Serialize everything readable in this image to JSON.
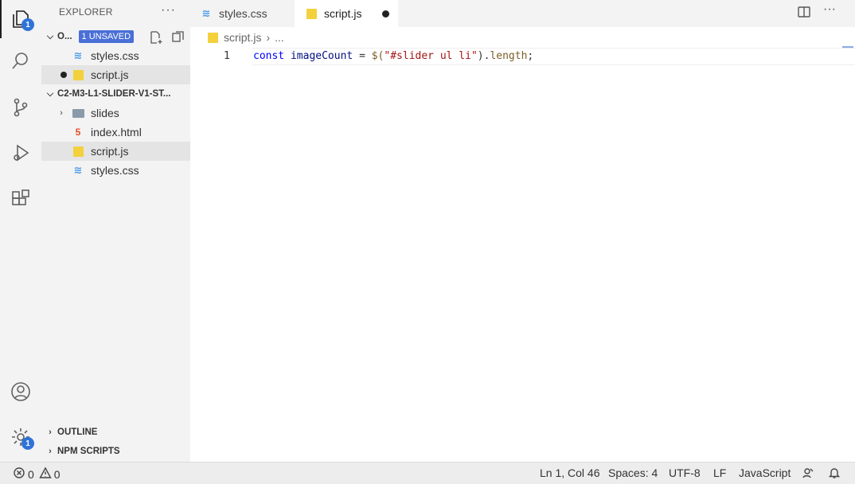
{
  "activity_bar": {
    "explorer_badge": "1",
    "settings_badge": "1"
  },
  "sidebar": {
    "title": "EXPLORER",
    "more": "···",
    "open_editors": {
      "label": "O...",
      "unsaved_badge": "1 UNSAVED",
      "files": [
        {
          "name": "styles.css",
          "type": "css"
        },
        {
          "name": "script.js",
          "type": "js"
        }
      ]
    },
    "folder": {
      "label": "C2-M3-L1-SLIDER-V1-ST...",
      "items": [
        {
          "name": "slides",
          "type": "folder"
        },
        {
          "name": "index.html",
          "type": "html"
        },
        {
          "name": "script.js",
          "type": "js"
        },
        {
          "name": "styles.css",
          "type": "css"
        }
      ]
    },
    "outline_label": "OUTLINE",
    "npm_label": "NPM SCRIPTS"
  },
  "tabs": [
    {
      "label": "styles.css",
      "type": "css",
      "active": false
    },
    {
      "label": "script.js",
      "type": "js",
      "active": true,
      "dirty": true
    }
  ],
  "breadcrumb": {
    "file": "script.js",
    "rest": "..."
  },
  "editor": {
    "lines": [
      {
        "number": "1",
        "tokens": {
          "kw": "const",
          "var": "imageCount",
          "eq": "=",
          "fn": "$(",
          "str": "\"#slider ul li\"",
          "close": ").",
          "prop": "length",
          "semi": ";"
        }
      }
    ]
  },
  "status_bar": {
    "errors": "0",
    "warnings": "0",
    "position": "Ln 1, Col 46",
    "spaces": "Spaces: 4",
    "encoding": "UTF-8",
    "eol": "LF",
    "language": "JavaScript"
  },
  "colors": {
    "accent": "#4a6fd6",
    "badge": "#2f73d8",
    "keyword": "#0000ff",
    "string": "#a31515"
  }
}
